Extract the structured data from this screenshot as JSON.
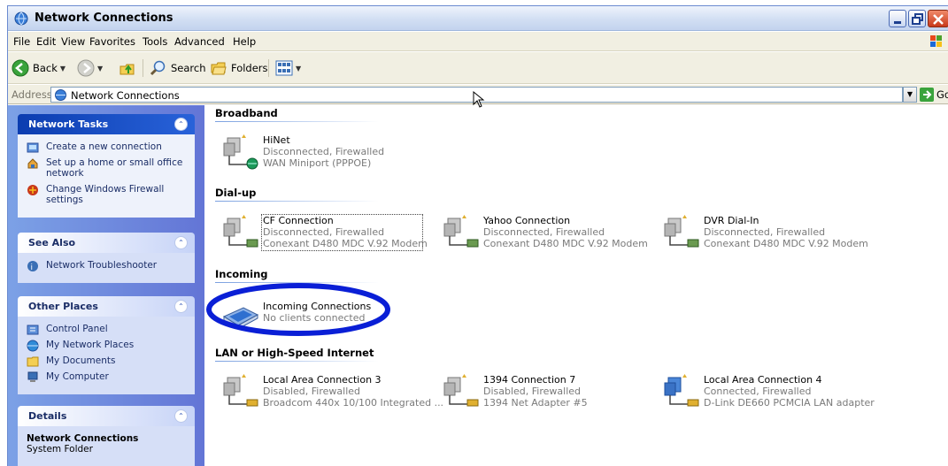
{
  "window": {
    "title": "Network Connections"
  },
  "menu": [
    "File",
    "Edit",
    "View",
    "Favorites",
    "Tools",
    "Advanced",
    "Help"
  ],
  "toolbar": {
    "back": "Back",
    "search": "Search",
    "folders": "Folders"
  },
  "address": {
    "label": "Address",
    "value": "Network Connections",
    "go": "Go"
  },
  "left_panels": {
    "network_tasks": {
      "title": "Network Tasks",
      "items": [
        "Create a new connection",
        "Set up a home or small office network",
        "Change Windows Firewall settings"
      ]
    },
    "see_also": {
      "title": "See Also",
      "items": [
        "Network Troubleshooter"
      ]
    },
    "other_places": {
      "title": "Other Places",
      "items": [
        "Control Panel",
        "My Network Places",
        "My Documents",
        "My Computer"
      ]
    },
    "details": {
      "title": "Details",
      "name": "Network Connections",
      "type": "System Folder"
    }
  },
  "groups": {
    "broadband": {
      "title": "Broadband",
      "items": [
        {
          "name": "HiNet",
          "status": "Disconnected, Firewalled",
          "device": "WAN Miniport (PPPOE)"
        }
      ]
    },
    "dialup": {
      "title": "Dial-up",
      "items": [
        {
          "name": "CF Connection",
          "status": "Disconnected, Firewalled",
          "device": "Conexant D480 MDC V.92 Modem"
        },
        {
          "name": "Yahoo Connection",
          "status": "Disconnected, Firewalled",
          "device": "Conexant D480 MDC V.92 Modem"
        },
        {
          "name": "DVR Dial-In",
          "status": "Disconnected, Firewalled",
          "device": "Conexant D480 MDC V.92 Modem"
        }
      ]
    },
    "incoming": {
      "title": "Incoming",
      "items": [
        {
          "name": "Incoming Connections",
          "status": "No clients connected"
        }
      ]
    },
    "lan": {
      "title": "LAN or High-Speed Internet",
      "items": [
        {
          "name": "Local Area Connection 3",
          "status": "Disabled, Firewalled",
          "device": "Broadcom 440x 10/100 Integrated ..."
        },
        {
          "name": "1394 Connection 7",
          "status": "Disabled, Firewalled",
          "device": "1394 Net Adapter #5"
        },
        {
          "name": "Local Area Connection 4",
          "status": "Connected, Firewalled",
          "device": "D-Link DE660 PCMCIA LAN adapter"
        }
      ]
    }
  },
  "colors": {
    "highlight_ellipse": "#0a1fd6",
    "panel_head_dark": "#0c3db0",
    "left_pane": "#7ca1e6"
  }
}
